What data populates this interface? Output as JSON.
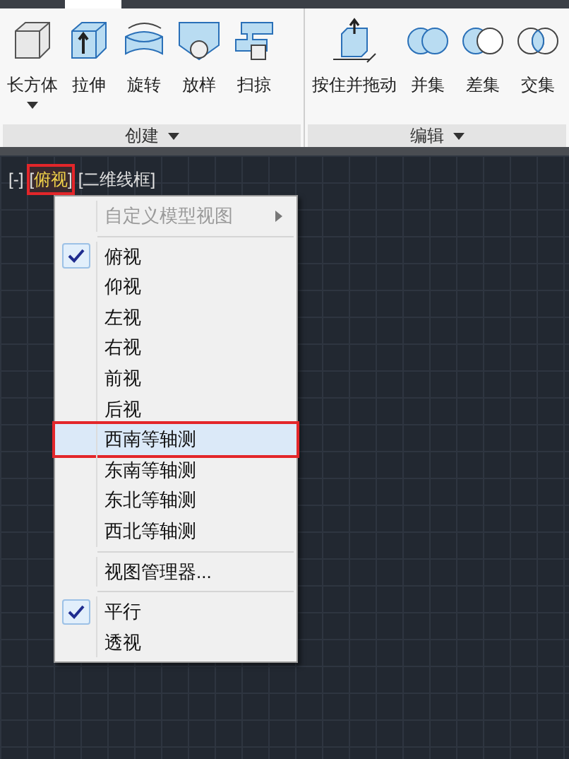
{
  "ribbon": {
    "panels": [
      {
        "title": "创建",
        "tools": [
          {
            "kind": "box",
            "label": "长方体",
            "dropdown": true
          },
          {
            "kind": "extrude",
            "label": "拉伸",
            "dropdown": false
          },
          {
            "kind": "revolve",
            "label": "旋转",
            "dropdown": false
          },
          {
            "kind": "loft",
            "label": "放样",
            "dropdown": false
          },
          {
            "kind": "sweep",
            "label": "扫掠",
            "dropdown": false
          }
        ]
      },
      {
        "title": "编辑",
        "tools": [
          {
            "kind": "presspull",
            "label": "按住并拖动",
            "dropdown": false
          },
          {
            "kind": "union",
            "label": "并集",
            "dropdown": false
          },
          {
            "kind": "subtract",
            "label": "差集",
            "dropdown": false
          },
          {
            "kind": "intersect",
            "label": "交集",
            "dropdown": false
          }
        ]
      }
    ]
  },
  "viewport_controls": [
    {
      "open": "[",
      "label": "-",
      "close": "]",
      "active": false,
      "highlighted": false
    },
    {
      "open": "[",
      "label": "俯视",
      "close": "]",
      "active": true,
      "highlighted": true
    },
    {
      "open": "[",
      "label": "二维线框",
      "close": "]",
      "active": false,
      "highlighted": false
    }
  ],
  "menu": {
    "items": [
      {
        "kind": "submenu",
        "label": "自定义模型视图",
        "disabled": true,
        "checked": false,
        "hovered": false,
        "highlighted": false
      },
      {
        "kind": "separator"
      },
      {
        "kind": "item",
        "label": "俯视",
        "disabled": false,
        "checked": true,
        "hovered": false,
        "highlighted": false
      },
      {
        "kind": "item",
        "label": "仰视",
        "disabled": false,
        "checked": false,
        "hovered": false,
        "highlighted": false
      },
      {
        "kind": "item",
        "label": "左视",
        "disabled": false,
        "checked": false,
        "hovered": false,
        "highlighted": false
      },
      {
        "kind": "item",
        "label": "右视",
        "disabled": false,
        "checked": false,
        "hovered": false,
        "highlighted": false
      },
      {
        "kind": "item",
        "label": "前视",
        "disabled": false,
        "checked": false,
        "hovered": false,
        "highlighted": false
      },
      {
        "kind": "item",
        "label": "后视",
        "disabled": false,
        "checked": false,
        "hovered": false,
        "highlighted": false
      },
      {
        "kind": "item",
        "label": "西南等轴测",
        "disabled": false,
        "checked": false,
        "hovered": true,
        "highlighted": true
      },
      {
        "kind": "item",
        "label": "东南等轴测",
        "disabled": false,
        "checked": false,
        "hovered": false,
        "highlighted": false
      },
      {
        "kind": "item",
        "label": "东北等轴测",
        "disabled": false,
        "checked": false,
        "hovered": false,
        "highlighted": false
      },
      {
        "kind": "item",
        "label": "西北等轴测",
        "disabled": false,
        "checked": false,
        "hovered": false,
        "highlighted": false
      },
      {
        "kind": "separator"
      },
      {
        "kind": "item",
        "label": "视图管理器...",
        "disabled": false,
        "checked": false,
        "hovered": false,
        "highlighted": false
      },
      {
        "kind": "separator"
      },
      {
        "kind": "item",
        "label": "平行",
        "disabled": false,
        "checked": true,
        "hovered": false,
        "highlighted": false
      },
      {
        "kind": "item",
        "label": "透视",
        "disabled": false,
        "checked": false,
        "hovered": false,
        "highlighted": false
      }
    ]
  }
}
